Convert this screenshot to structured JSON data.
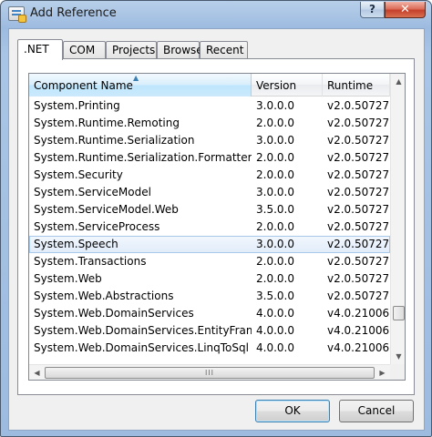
{
  "window": {
    "title": "Add Reference",
    "help_label": "?",
    "close_label": "✕"
  },
  "tabs": [
    {
      "label": ".NET",
      "active": true
    },
    {
      "label": "COM",
      "active": false
    },
    {
      "label": "Projects",
      "active": false
    },
    {
      "label": "Browse",
      "active": false
    },
    {
      "label": "Recent",
      "active": false
    }
  ],
  "list": {
    "sort_glyph": "▲",
    "columns": [
      "Component Name",
      "Version",
      "Runtime"
    ],
    "rows": [
      {
        "name": "System.Printing",
        "version": "3.0.0.0",
        "runtime": "v2.0.50727"
      },
      {
        "name": "System.Runtime.Remoting",
        "version": "2.0.0.0",
        "runtime": "v2.0.50727"
      },
      {
        "name": "System.Runtime.Serialization",
        "version": "3.0.0.0",
        "runtime": "v2.0.50727"
      },
      {
        "name": "System.Runtime.Serialization.Formatters.So...",
        "version": "2.0.0.0",
        "runtime": "v2.0.50727"
      },
      {
        "name": "System.Security",
        "version": "2.0.0.0",
        "runtime": "v2.0.50727"
      },
      {
        "name": "System.ServiceModel",
        "version": "3.0.0.0",
        "runtime": "v2.0.50727"
      },
      {
        "name": "System.ServiceModel.Web",
        "version": "3.5.0.0",
        "runtime": "v2.0.50727"
      },
      {
        "name": "System.ServiceProcess",
        "version": "2.0.0.0",
        "runtime": "v2.0.50727"
      },
      {
        "name": "System.Speech",
        "version": "3.0.0.0",
        "runtime": "v2.0.50727",
        "selected": true
      },
      {
        "name": "System.Transactions",
        "version": "2.0.0.0",
        "runtime": "v2.0.50727"
      },
      {
        "name": "System.Web",
        "version": "2.0.0.0",
        "runtime": "v2.0.50727"
      },
      {
        "name": "System.Web.Abstractions",
        "version": "3.5.0.0",
        "runtime": "v2.0.50727"
      },
      {
        "name": "System.Web.DomainServices",
        "version": "4.0.0.0",
        "runtime": "v4.0.21006"
      },
      {
        "name": "System.Web.DomainServices.EntityFramew...",
        "version": "4.0.0.0",
        "runtime": "v4.0.21006"
      },
      {
        "name": "System.Web.DomainServices.LinqToSql",
        "version": "4.0.0.0",
        "runtime": "v4.0.21006"
      }
    ]
  },
  "scroll": {
    "up": "▲",
    "down": "▼",
    "left": "◀",
    "right": "▶",
    "grip": "III"
  },
  "buttons": {
    "ok": "OK",
    "cancel": "Cancel"
  }
}
